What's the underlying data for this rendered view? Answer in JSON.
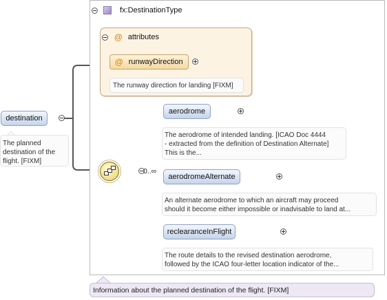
{
  "type": {
    "name": "fx:DestinationType"
  },
  "attributes_group": {
    "label": "attributes",
    "at_symbol": "@"
  },
  "attribute": {
    "name": "runwayDirection",
    "doc": "The runway direction for landing [FIXM]"
  },
  "root_element": {
    "name": "destination",
    "doc_line1": "The planned",
    "doc_line2": "destination of the",
    "doc_line3": "flight. [FIXM]"
  },
  "sequence": {
    "cardinality": "0..∞"
  },
  "elements": [
    {
      "name": "aerodrome",
      "doc_line1": "The aerodrome of intended landing. [ICAO Doc 4444",
      "doc_line2": "- extracted from the definition of Destination Alternate]",
      "doc_line3": "This is the..."
    },
    {
      "name": "aerodromeAlternate",
      "doc_line1": "An alternate aerodrome to which an aircraft may proceed",
      "doc_line2": "should it become either impossible or inadvisable to land at..."
    },
    {
      "name": "reclearanceInFlight",
      "doc_line1": "The route details to the revised destination aerodrome,",
      "doc_line2": "followed by the ICAO four-letter location indicator of the..."
    }
  ],
  "type_doc": "Information about the planned destination of the flight. [FIXM]",
  "colors": {
    "element_fill": "#c5d4eb",
    "attribute_fill": "#f5d9a4",
    "attributes_group_fill": "#fdf3e3",
    "sequence_fill": "#f0dd86",
    "type_swatch": "#9b86c4"
  }
}
